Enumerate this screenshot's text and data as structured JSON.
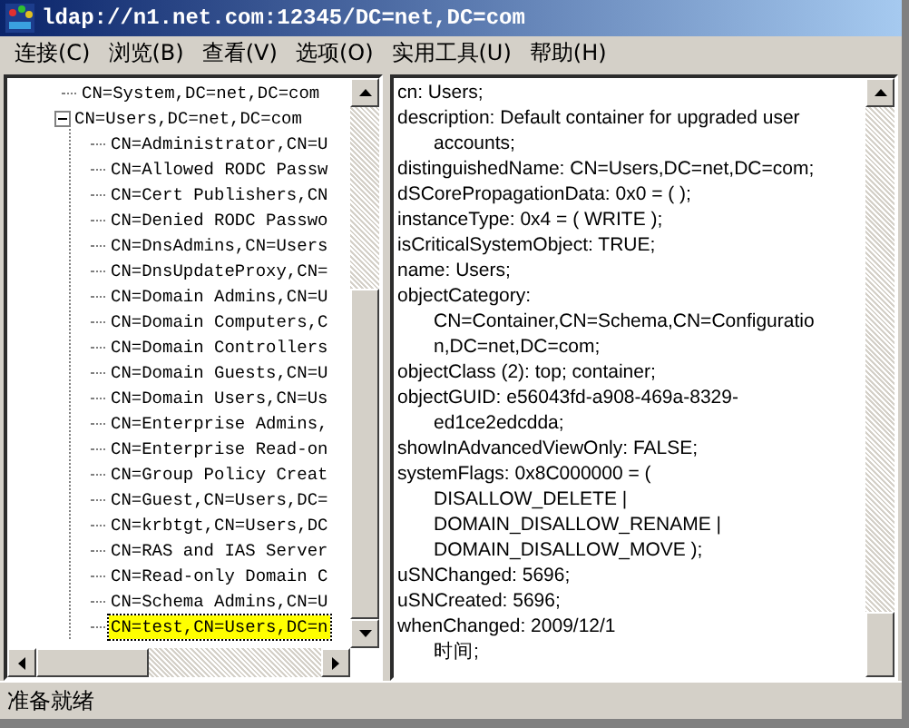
{
  "window": {
    "title": "ldap://n1.net.com:12345/DC=net,DC=com"
  },
  "menu": [
    "连接(C)",
    "浏览(B)",
    "查看(V)",
    "选项(O)",
    "实用工具(U)",
    "帮助(H)"
  ],
  "tree": {
    "items": [
      {
        "label": "CN=System,DC=net,DC=com",
        "selected": false
      },
      {
        "label": "CN=Users,DC=net,DC=com",
        "selected": false,
        "expanded": true,
        "children": [
          {
            "label": "CN=Administrator,CN=U",
            "selected": false
          },
          {
            "label": "CN=Allowed RODC Passw",
            "selected": false
          },
          {
            "label": "CN=Cert Publishers,CN",
            "selected": false
          },
          {
            "label": "CN=Denied RODC Passwo",
            "selected": false
          },
          {
            "label": "CN=DnsAdmins,CN=Users",
            "selected": false
          },
          {
            "label": "CN=DnsUpdateProxy,CN=",
            "selected": false
          },
          {
            "label": "CN=Domain Admins,CN=U",
            "selected": false
          },
          {
            "label": "CN=Domain Computers,C",
            "selected": false
          },
          {
            "label": "CN=Domain Controllers",
            "selected": false
          },
          {
            "label": "CN=Domain Guests,CN=U",
            "selected": false
          },
          {
            "label": "CN=Domain Users,CN=Us",
            "selected": false
          },
          {
            "label": "CN=Enterprise Admins,",
            "selected": false
          },
          {
            "label": "CN=Enterprise Read-on",
            "selected": false
          },
          {
            "label": "CN=Group Policy Creat",
            "selected": false
          },
          {
            "label": "CN=Guest,CN=Users,DC=",
            "selected": false
          },
          {
            "label": "CN=krbtgt,CN=Users,DC",
            "selected": false
          },
          {
            "label": "CN=RAS and IAS Server",
            "selected": false
          },
          {
            "label": "CN=Read-only Domain C",
            "selected": false
          },
          {
            "label": "CN=Schema Admins,CN=U",
            "selected": false
          },
          {
            "label": "CN=test,CN=Users,DC=n",
            "selected": true
          }
        ]
      }
    ]
  },
  "details": {
    "entries": [
      {
        "lines": [
          "cn: Users;"
        ]
      },
      {
        "lines": [
          "description: Default container for upgraded user",
          "accounts;"
        ]
      },
      {
        "lines": [
          "distinguishedName: CN=Users,DC=net,DC=com;"
        ]
      },
      {
        "lines": [
          "dSCorePropagationData: 0x0 = (  );"
        ]
      },
      {
        "lines": [
          "instanceType: 0x4 = ( WRITE );"
        ]
      },
      {
        "lines": [
          "isCriticalSystemObject: TRUE;"
        ]
      },
      {
        "lines": [
          "name: Users;"
        ]
      },
      {
        "lines": [
          "objectCategory:",
          "CN=Container,CN=Schema,CN=Configuratio",
          "n,DC=net,DC=com;"
        ]
      },
      {
        "lines": [
          "objectClass (2): top; container;"
        ]
      },
      {
        "lines": [
          "objectGUID: e56043fd-a908-469a-8329-",
          "ed1ce2edcdda;"
        ]
      },
      {
        "lines": [
          "showInAdvancedViewOnly: FALSE;"
        ]
      },
      {
        "lines": [
          "systemFlags: 0x8C000000 = (",
          "DISALLOW_DELETE |",
          "DOMAIN_DISALLOW_RENAME |",
          "DOMAIN_DISALLOW_MOVE );"
        ]
      },
      {
        "lines": [
          "uSNChanged: 5696;"
        ]
      },
      {
        "lines": [
          "uSNCreated: 5696;"
        ]
      },
      {
        "lines": [
          "whenChanged: 2009/12/1",
          "时间;"
        ]
      }
    ]
  },
  "status_bar": "准备就绪"
}
